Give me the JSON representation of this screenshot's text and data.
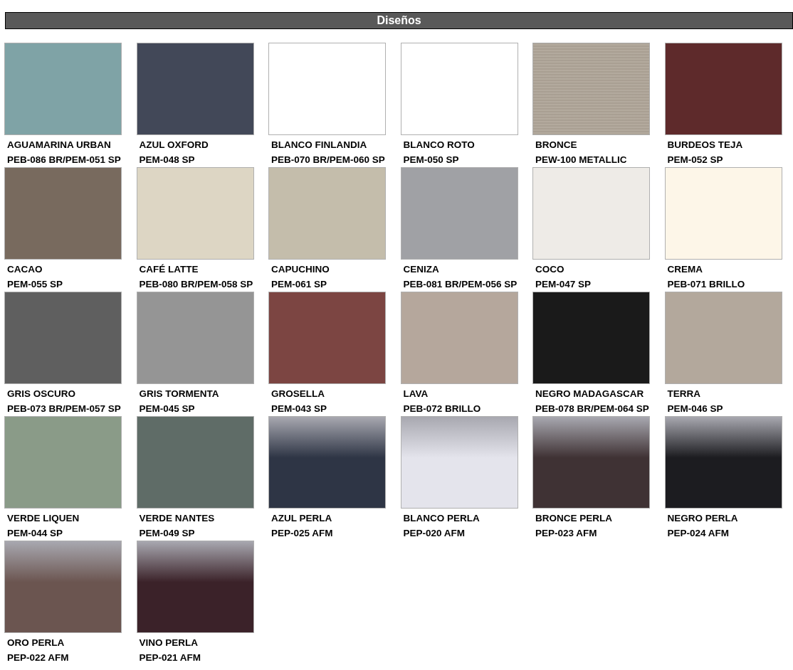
{
  "header": {
    "title": "Diseños"
  },
  "swatches": [
    {
      "name": "AGUAMARINA URBAN",
      "code": "PEB-086 BR/PEM-051 SP",
      "kind": "solid",
      "color": "#7fa3a6"
    },
    {
      "name": "AZUL OXFORD",
      "code": "PEM-048 SP",
      "kind": "solid",
      "color": "#424858"
    },
    {
      "name": "BLANCO FINLANDIA",
      "code": "PEB-070 BR/PEM-060 SP",
      "kind": "solid",
      "color": "#ffffff"
    },
    {
      "name": "BLANCO ROTO",
      "code": "PEM-050 SP",
      "kind": "solid",
      "color": "#ffffff"
    },
    {
      "name": "BRONCE",
      "code": "PEW-100 METALLIC",
      "kind": "metallic",
      "color": "#a49a8d"
    },
    {
      "name": "BURDEOS TEJA",
      "code": "PEM-052 SP",
      "kind": "solid",
      "color": "#5e2a2b"
    },
    {
      "name": "CACAO",
      "code": "PEM-055 SP",
      "kind": "solid",
      "color": "#786a5e"
    },
    {
      "name": "CAFÉ LATTE",
      "code": "PEB-080 BR/PEM-058 SP",
      "kind": "solid",
      "color": "#ddd6c4"
    },
    {
      "name": "CAPUCHINO",
      "code": "PEM-061 SP",
      "kind": "solid",
      "color": "#c4bdab"
    },
    {
      "name": "CENIZA",
      "code": "PEB-081 BR/PEM-056 SP",
      "kind": "solid",
      "color": "#a0a1a5"
    },
    {
      "name": "COCO",
      "code": "PEM-047 SP",
      "kind": "solid",
      "color": "#eeebe7"
    },
    {
      "name": "CREMA",
      "code": "PEB-071 BRILLO",
      "kind": "solid",
      "color": "#fdf6e8"
    },
    {
      "name": "GRIS OSCURO",
      "code": "PEB-073 BR/PEM-057 SP",
      "kind": "solid",
      "color": "#5f5f5f"
    },
    {
      "name": "GRIS TORMENTA",
      "code": "PEM-045 SP",
      "kind": "solid",
      "color": "#959595"
    },
    {
      "name": "GROSELLA",
      "code": "PEM-043 SP",
      "kind": "solid",
      "color": "#7c4542"
    },
    {
      "name": "LAVA",
      "code": "PEB-072 BRILLO",
      "kind": "solid",
      "color": "#b5a79c"
    },
    {
      "name": "NEGRO MADAGASCAR",
      "code": "PEB-078 BR/PEM-064 SP",
      "kind": "solid",
      "color": "#1a1a1a"
    },
    {
      "name": "TERRA",
      "code": "PEM-046 SP",
      "kind": "solid",
      "color": "#b3a89c"
    },
    {
      "name": "VERDE LIQUEN",
      "code": "PEM-044 SP",
      "kind": "solid",
      "color": "#8a9b88"
    },
    {
      "name": "VERDE NANTES",
      "code": "PEM-049 SP",
      "kind": "solid",
      "color": "#5f6c67"
    },
    {
      "name": "AZUL PERLA",
      "code": "PEP-025 AFM",
      "kind": "pearl",
      "color": "#2e3545"
    },
    {
      "name": "BLANCO PERLA",
      "code": "PEP-020 AFM",
      "kind": "pearl",
      "color": "#e4e4ec"
    },
    {
      "name": "BRONCE PERLA",
      "code": "PEP-023 AFM",
      "kind": "pearl",
      "color": "#3f3234"
    },
    {
      "name": "NEGRO PERLA",
      "code": "PEP-024 AFM",
      "kind": "pearl",
      "color": "#1c1c20"
    },
    {
      "name": "ORO PERLA",
      "code": "PEP-022 AFM",
      "kind": "pearl",
      "color": "#6b5550"
    },
    {
      "name": "VINO PERLA",
      "code": "PEP-021 AFM",
      "kind": "pearl",
      "color": "#3b2229"
    }
  ]
}
